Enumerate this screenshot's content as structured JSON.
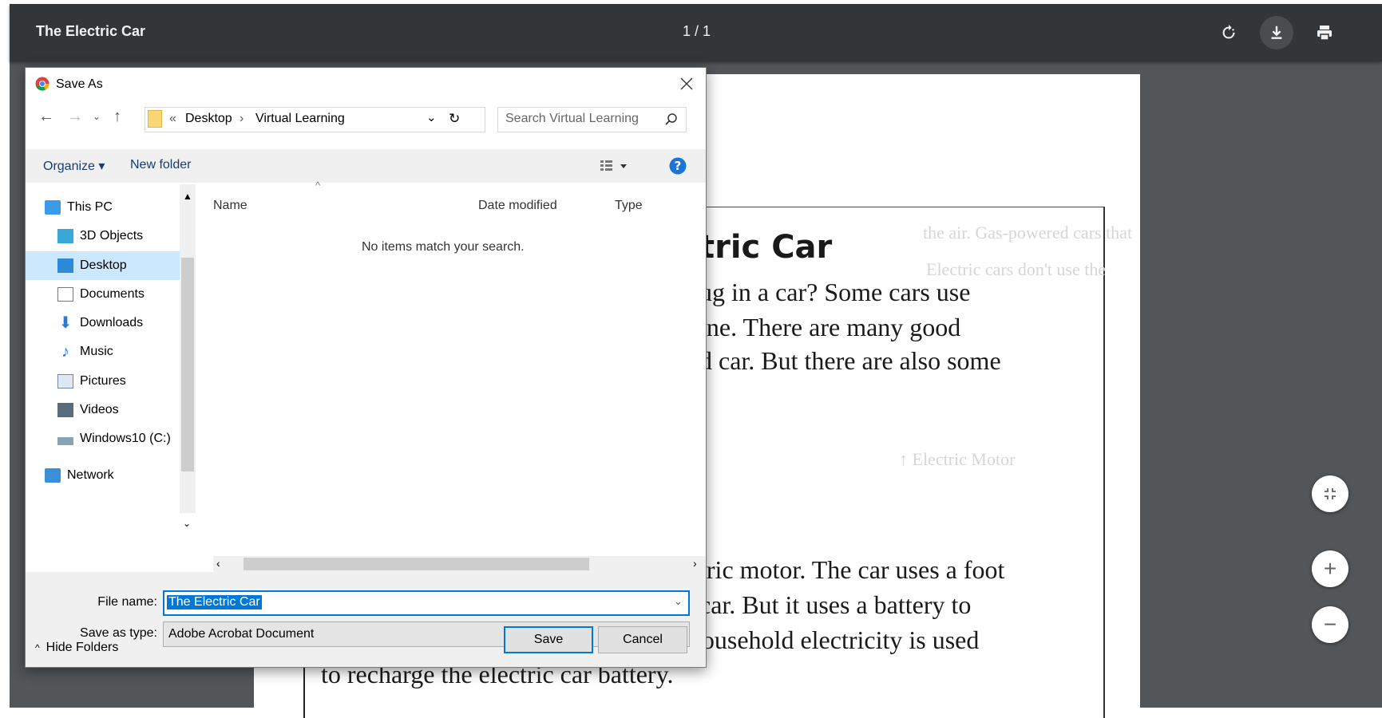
{
  "viewer": {
    "title": "The Electric Car",
    "page_indicator": "1 / 1"
  },
  "pdf": {
    "heading": "tric Car",
    "lines": [
      "ug in a car? Some cars use",
      "ine. There are many good",
      "d car. But there are also some",
      "tric motor. The car uses a foot",
      "car. But it uses a battery to",
      "power the motor, not gas. Common household electricity is used",
      "to recharge the electric car battery."
    ]
  },
  "dialog": {
    "title": "Save As",
    "breadcrumb": [
      "«",
      "Desktop",
      "›",
      "Virtual Learning"
    ],
    "search_placeholder": "Search Virtual Learning",
    "organize_label": "Organize ▾",
    "new_folder_label": "New folder",
    "nav_items": [
      {
        "label": "This PC",
        "icon": "computer-icon"
      },
      {
        "label": "3D Objects",
        "icon": "cube-icon"
      },
      {
        "label": "Desktop",
        "icon": "desktop-icon"
      },
      {
        "label": "Documents",
        "icon": "document-icon"
      },
      {
        "label": "Downloads",
        "icon": "download-arrow-icon"
      },
      {
        "label": "Music",
        "icon": "music-note-icon"
      },
      {
        "label": "Pictures",
        "icon": "picture-icon"
      },
      {
        "label": "Videos",
        "icon": "film-icon"
      },
      {
        "label": "Windows10 (C:)",
        "icon": "drive-icon"
      },
      {
        "label": "Network",
        "icon": "network-icon"
      }
    ],
    "columns": [
      "Name",
      "Date modified",
      "Type"
    ],
    "empty_message": "No items match your search.",
    "file_name_label": "File name:",
    "file_name_value": "The Electric Car",
    "save_type_label": "Save as type:",
    "save_type_value": "Adobe Acrobat Document",
    "hide_folders_label": "Hide Folders",
    "save_button": "Save",
    "cancel_button": "Cancel"
  },
  "colors": {
    "toolbar": "#323639",
    "viewer_bg": "#525659",
    "accent": "#0078d7",
    "selected_nav": "#cce8ff"
  }
}
